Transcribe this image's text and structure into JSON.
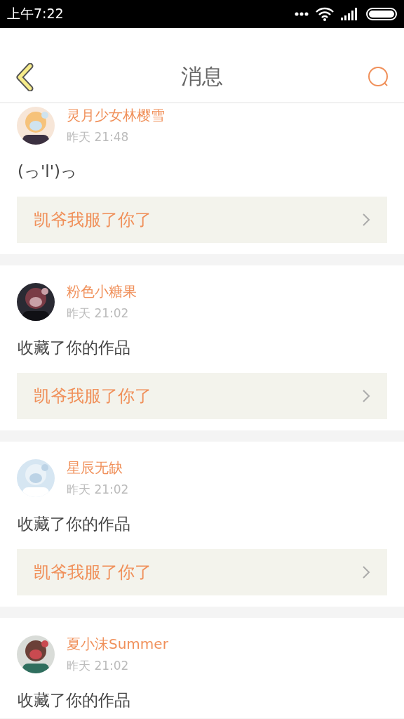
{
  "status_bar": {
    "time": "上午7:22"
  },
  "header": {
    "title": "消息"
  },
  "messages": [
    {
      "name": "灵月少女林樱雪",
      "time": "昨天 21:48",
      "text": "(っ'l')っ",
      "quote": "凯爷我服了你了"
    },
    {
      "name": "粉色小糖果",
      "time": "昨天 21:02",
      "text": "收藏了你的作品",
      "quote": "凯爷我服了你了"
    },
    {
      "name": "星辰无缺",
      "time": "昨天 21:02",
      "text": "收藏了你的作品",
      "quote": "凯爷我服了你了"
    },
    {
      "name": "夏小沫Summer",
      "time": "昨天 21:02",
      "text": "收藏了你的作品"
    }
  ]
}
